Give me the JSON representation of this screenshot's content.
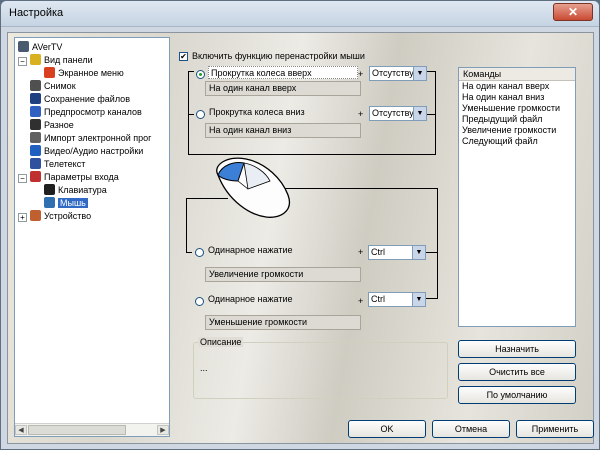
{
  "window": {
    "title": "Настройка",
    "close_glyph": "✕"
  },
  "tree": {
    "items": [
      {
        "label": "AVerTV",
        "icon": "app-icon",
        "color": "#4a5a6e"
      },
      {
        "label": "Вид панели",
        "icon": "panel-view-icon",
        "color": "#d8b020"
      },
      {
        "label": "Экранное меню",
        "icon": "osd-menu-icon",
        "color": "#d84020"
      },
      {
        "label": "Снимок",
        "icon": "camera-icon",
        "color": "#505050"
      },
      {
        "label": "Сохранение файлов",
        "icon": "save-icon",
        "color": "#204080"
      },
      {
        "label": "Предпросмотр каналов",
        "icon": "eye-icon",
        "color": "#3060c0"
      },
      {
        "label": "Разное",
        "icon": "misc-icon",
        "color": "#303030"
      },
      {
        "label": "Импорт электронной прог",
        "icon": "import-icon",
        "color": "#606060"
      },
      {
        "label": "Видео/Аудио настройки",
        "icon": "tools-icon",
        "color": "#2060c0"
      },
      {
        "label": "Телетекст",
        "icon": "teletext-icon",
        "color": "#3050a0"
      },
      {
        "label": "Параметры входа",
        "icon": "input-params-icon",
        "color": "#c03030"
      },
      {
        "label": "Клавиатура",
        "icon": "keyboard-icon",
        "color": "#202020"
      },
      {
        "label": "Мышь",
        "icon": "mouse-icon",
        "color": "#3070b0"
      },
      {
        "label": "Устройство",
        "icon": "device-icon",
        "color": "#c06030"
      }
    ],
    "expander_minus": "−",
    "expander_plus": "+",
    "scroll_left": "◀",
    "scroll_right": "▶"
  },
  "mouse": {
    "enable_label": "Включить функцию перенастройки мыши",
    "enable_checked": "✔",
    "wheel_up": {
      "label": "Прокрутка колеса вверх",
      "action": "На один канал вверх",
      "modifier": "Отсутству"
    },
    "wheel_down": {
      "label": "Прокрутка колеса вниз",
      "action": "На один канал вниз",
      "modifier": "Отсутству"
    },
    "left_click": {
      "label": "Одинарное нажатие",
      "action": "Увеличение громкости",
      "modifier": "Ctrl"
    },
    "right_click": {
      "label": "Одинарное нажатие",
      "action": "Уменьшение громкости",
      "modifier": "Ctrl"
    },
    "plus": "+",
    "dropdown_arrow": "▼"
  },
  "commands": {
    "header": "Команды",
    "items": [
      "На один канал вверх",
      "На один канал вниз",
      "Уменьшение громкости",
      "Предыдущий файл",
      "Увеличение громкости",
      "Следующий файл"
    ]
  },
  "buttons": {
    "assign": "Назначить",
    "clear_all": "Очистить все",
    "default": "По умолчанию",
    "ok": "OK",
    "cancel": "Отмена",
    "apply": "Применить"
  },
  "description": {
    "title": "Описание",
    "text": "..."
  }
}
